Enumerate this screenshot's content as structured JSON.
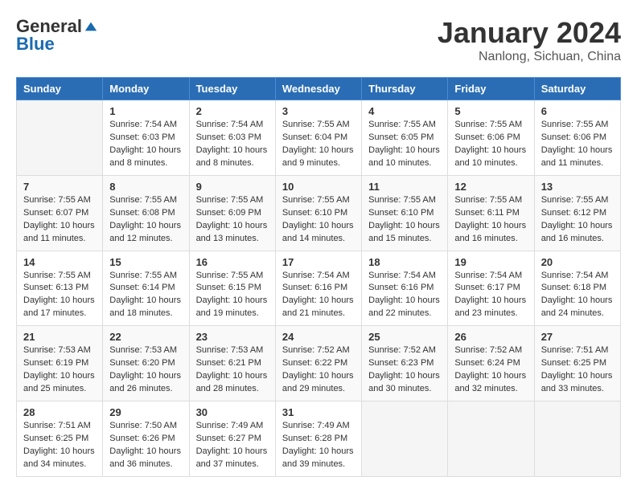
{
  "logo": {
    "general": "General",
    "blue": "Blue"
  },
  "header": {
    "month": "January 2024",
    "location": "Nanlong, Sichuan, China"
  },
  "weekdays": [
    "Sunday",
    "Monday",
    "Tuesday",
    "Wednesday",
    "Thursday",
    "Friday",
    "Saturday"
  ],
  "weeks": [
    [
      {
        "day": null
      },
      {
        "day": 1,
        "sunrise": "Sunrise: 7:54 AM",
        "sunset": "Sunset: 6:03 PM",
        "daylight": "Daylight: 10 hours and 8 minutes."
      },
      {
        "day": 2,
        "sunrise": "Sunrise: 7:54 AM",
        "sunset": "Sunset: 6:03 PM",
        "daylight": "Daylight: 10 hours and 8 minutes."
      },
      {
        "day": 3,
        "sunrise": "Sunrise: 7:55 AM",
        "sunset": "Sunset: 6:04 PM",
        "daylight": "Daylight: 10 hours and 9 minutes."
      },
      {
        "day": 4,
        "sunrise": "Sunrise: 7:55 AM",
        "sunset": "Sunset: 6:05 PM",
        "daylight": "Daylight: 10 hours and 10 minutes."
      },
      {
        "day": 5,
        "sunrise": "Sunrise: 7:55 AM",
        "sunset": "Sunset: 6:06 PM",
        "daylight": "Daylight: 10 hours and 10 minutes."
      },
      {
        "day": 6,
        "sunrise": "Sunrise: 7:55 AM",
        "sunset": "Sunset: 6:06 PM",
        "daylight": "Daylight: 10 hours and 11 minutes."
      }
    ],
    [
      {
        "day": 7,
        "sunrise": "Sunrise: 7:55 AM",
        "sunset": "Sunset: 6:07 PM",
        "daylight": "Daylight: 10 hours and 11 minutes."
      },
      {
        "day": 8,
        "sunrise": "Sunrise: 7:55 AM",
        "sunset": "Sunset: 6:08 PM",
        "daylight": "Daylight: 10 hours and 12 minutes."
      },
      {
        "day": 9,
        "sunrise": "Sunrise: 7:55 AM",
        "sunset": "Sunset: 6:09 PM",
        "daylight": "Daylight: 10 hours and 13 minutes."
      },
      {
        "day": 10,
        "sunrise": "Sunrise: 7:55 AM",
        "sunset": "Sunset: 6:10 PM",
        "daylight": "Daylight: 10 hours and 14 minutes."
      },
      {
        "day": 11,
        "sunrise": "Sunrise: 7:55 AM",
        "sunset": "Sunset: 6:10 PM",
        "daylight": "Daylight: 10 hours and 15 minutes."
      },
      {
        "day": 12,
        "sunrise": "Sunrise: 7:55 AM",
        "sunset": "Sunset: 6:11 PM",
        "daylight": "Daylight: 10 hours and 16 minutes."
      },
      {
        "day": 13,
        "sunrise": "Sunrise: 7:55 AM",
        "sunset": "Sunset: 6:12 PM",
        "daylight": "Daylight: 10 hours and 16 minutes."
      }
    ],
    [
      {
        "day": 14,
        "sunrise": "Sunrise: 7:55 AM",
        "sunset": "Sunset: 6:13 PM",
        "daylight": "Daylight: 10 hours and 17 minutes."
      },
      {
        "day": 15,
        "sunrise": "Sunrise: 7:55 AM",
        "sunset": "Sunset: 6:14 PM",
        "daylight": "Daylight: 10 hours and 18 minutes."
      },
      {
        "day": 16,
        "sunrise": "Sunrise: 7:55 AM",
        "sunset": "Sunset: 6:15 PM",
        "daylight": "Daylight: 10 hours and 19 minutes."
      },
      {
        "day": 17,
        "sunrise": "Sunrise: 7:54 AM",
        "sunset": "Sunset: 6:16 PM",
        "daylight": "Daylight: 10 hours and 21 minutes."
      },
      {
        "day": 18,
        "sunrise": "Sunrise: 7:54 AM",
        "sunset": "Sunset: 6:16 PM",
        "daylight": "Daylight: 10 hours and 22 minutes."
      },
      {
        "day": 19,
        "sunrise": "Sunrise: 7:54 AM",
        "sunset": "Sunset: 6:17 PM",
        "daylight": "Daylight: 10 hours and 23 minutes."
      },
      {
        "day": 20,
        "sunrise": "Sunrise: 7:54 AM",
        "sunset": "Sunset: 6:18 PM",
        "daylight": "Daylight: 10 hours and 24 minutes."
      }
    ],
    [
      {
        "day": 21,
        "sunrise": "Sunrise: 7:53 AM",
        "sunset": "Sunset: 6:19 PM",
        "daylight": "Daylight: 10 hours and 25 minutes."
      },
      {
        "day": 22,
        "sunrise": "Sunrise: 7:53 AM",
        "sunset": "Sunset: 6:20 PM",
        "daylight": "Daylight: 10 hours and 26 minutes."
      },
      {
        "day": 23,
        "sunrise": "Sunrise: 7:53 AM",
        "sunset": "Sunset: 6:21 PM",
        "daylight": "Daylight: 10 hours and 28 minutes."
      },
      {
        "day": 24,
        "sunrise": "Sunrise: 7:52 AM",
        "sunset": "Sunset: 6:22 PM",
        "daylight": "Daylight: 10 hours and 29 minutes."
      },
      {
        "day": 25,
        "sunrise": "Sunrise: 7:52 AM",
        "sunset": "Sunset: 6:23 PM",
        "daylight": "Daylight: 10 hours and 30 minutes."
      },
      {
        "day": 26,
        "sunrise": "Sunrise: 7:52 AM",
        "sunset": "Sunset: 6:24 PM",
        "daylight": "Daylight: 10 hours and 32 minutes."
      },
      {
        "day": 27,
        "sunrise": "Sunrise: 7:51 AM",
        "sunset": "Sunset: 6:25 PM",
        "daylight": "Daylight: 10 hours and 33 minutes."
      }
    ],
    [
      {
        "day": 28,
        "sunrise": "Sunrise: 7:51 AM",
        "sunset": "Sunset: 6:25 PM",
        "daylight": "Daylight: 10 hours and 34 minutes."
      },
      {
        "day": 29,
        "sunrise": "Sunrise: 7:50 AM",
        "sunset": "Sunset: 6:26 PM",
        "daylight": "Daylight: 10 hours and 36 minutes."
      },
      {
        "day": 30,
        "sunrise": "Sunrise: 7:49 AM",
        "sunset": "Sunset: 6:27 PM",
        "daylight": "Daylight: 10 hours and 37 minutes."
      },
      {
        "day": 31,
        "sunrise": "Sunrise: 7:49 AM",
        "sunset": "Sunset: 6:28 PM",
        "daylight": "Daylight: 10 hours and 39 minutes."
      },
      {
        "day": null
      },
      {
        "day": null
      },
      {
        "day": null
      }
    ]
  ]
}
